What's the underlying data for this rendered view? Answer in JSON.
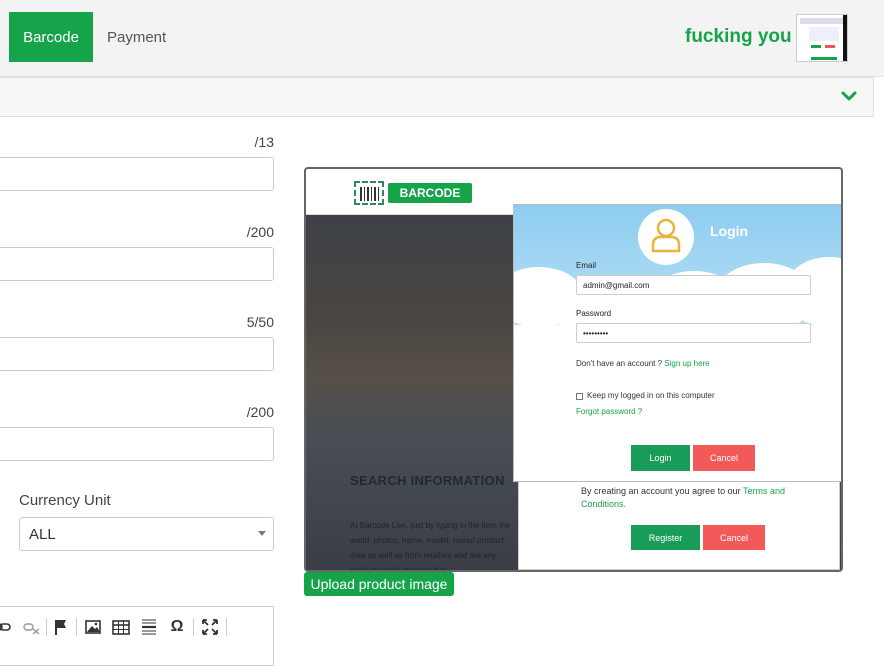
{
  "header": {
    "tabs": [
      {
        "label": "Barcode",
        "active": true
      },
      {
        "label": "Payment",
        "active": false
      }
    ],
    "username": "fucking you",
    "accent_color": "#16a34a"
  },
  "section": {
    "toggle_icon": "chevron-down-icon"
  },
  "form": {
    "counters": [
      "/13",
      "/200",
      "5/50",
      "/200"
    ],
    "currency": {
      "label": "Currency Unit",
      "selected": "ALL"
    },
    "toolbar_icons": [
      "link-icon",
      "unlink-icon",
      "flag-icon",
      "image-icon",
      "table-icon",
      "horizontal-line-icon",
      "omega-icon",
      "fullscreen-icon"
    ],
    "toolbar_glyphs": {
      "omega": "Ω"
    }
  },
  "preview": {
    "logo_text": "BARCODE",
    "login": {
      "title": "Login",
      "email_label": "Email",
      "email_value": "admin@gmail.com",
      "password_label": "Password",
      "password_value": "•••••••••",
      "no_account_text": "Don't have an account ?",
      "signup_link": "Sign up here",
      "remember_label": "Keep my logged in on this computer",
      "forgot_link": "Forgot password ?",
      "login_button": "Login",
      "cancel_button": "Cancel"
    },
    "register": {
      "terms_text": "By creating an account you agree to our",
      "terms_link": "Terms and Conditions.",
      "register_button": "Register",
      "cancel_button": "Cancel"
    },
    "background": {
      "heading": "SEARCH INFORMATION",
      "paragraph": "At Barcode Live, just by typing in the item the world: photos, name, model, manuf product data as well as from retailers and are any product you're interested in"
    }
  },
  "upload_button": "Upload product image"
}
